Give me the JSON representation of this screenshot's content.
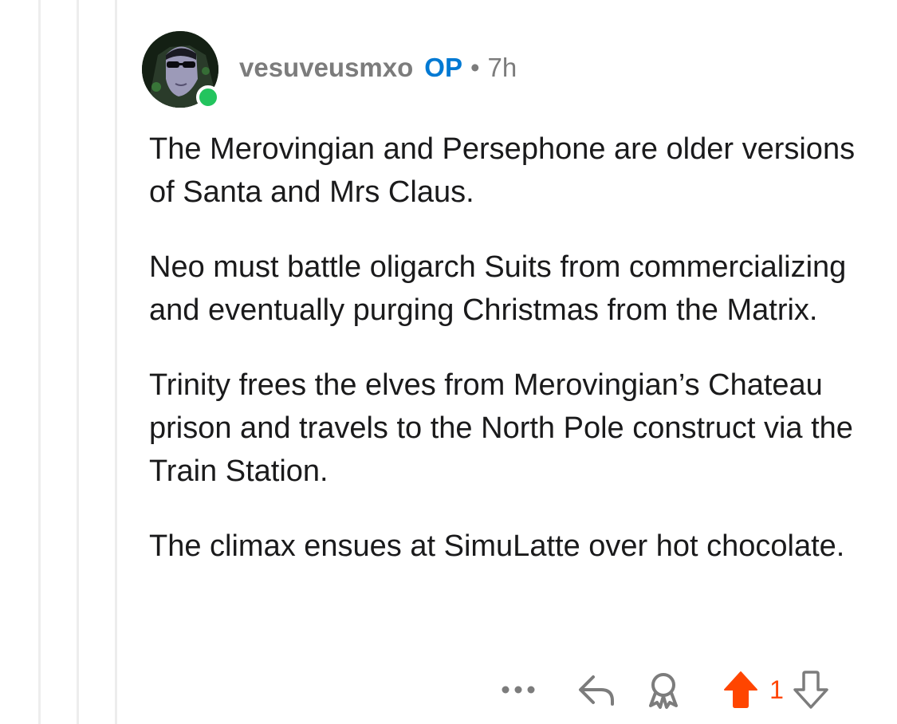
{
  "comment": {
    "author": "vesuveusmxo",
    "op_label": "OP",
    "separator": "•",
    "age": "7h",
    "avatar_icon": "user-avatar-icon",
    "online": true,
    "paragraphs": [
      "The Merovingian and Persephone are older versions of Santa and Mrs Claus.",
      "Neo must battle oligarch Suits from commercializing and eventually purging Christmas from the Matrix.",
      "Trinity frees the elves from Merovingian’s Chateau prison and travels to the North Pole construct via the Train Station.",
      "The climax ensues at SimuLatte over hot chocolate."
    ],
    "actions": {
      "more_icon": "more-icon",
      "reply_icon": "reply-icon",
      "award_icon": "award-icon",
      "upvote_icon": "upvote-icon",
      "score": "1",
      "downvote_icon": "downvote-icon",
      "upvoted": true
    }
  },
  "colors": {
    "op": "#0079d3",
    "meta": "#7c7c7c",
    "upvote": "#ff4500",
    "online": "#23c45e",
    "thread_line": "#ededed"
  }
}
